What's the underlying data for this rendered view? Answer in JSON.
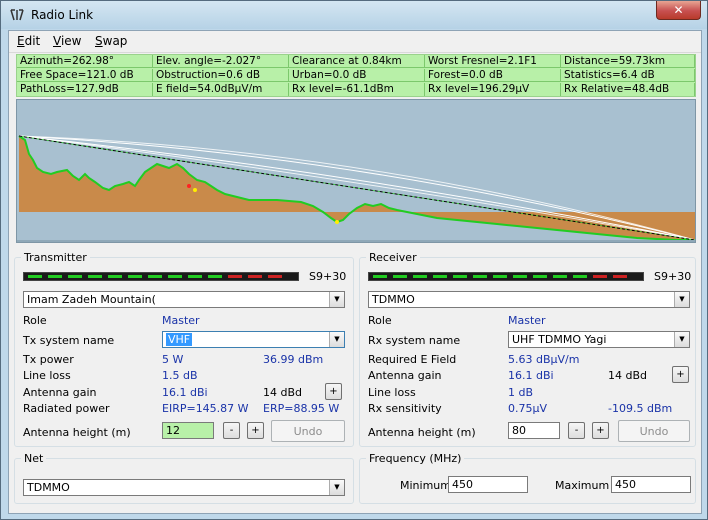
{
  "window": {
    "title": "Radio Link",
    "close_label": "✕"
  },
  "menu": [
    {
      "label": "Edit",
      "accel": "E",
      "rest": "dit"
    },
    {
      "label": "View",
      "accel": "V",
      "rest": "iew"
    },
    {
      "label": "Swap",
      "accel": "S",
      "rest": "wap"
    }
  ],
  "stats": {
    "row1": [
      "Azimuth=262.98°",
      "Elev. angle=-2.027°",
      "Clearance at 0.84km",
      "Worst Fresnel=2.1F1",
      "Distance=59.73km"
    ],
    "row2": [
      "Free Space=121.0 dB",
      "Obstruction=0.6 dB",
      "Urban=0.0 dB",
      "Forest=0.0 dB",
      "Statistics=6.4 dB"
    ],
    "row3": [
      "PathLoss=127.9dB",
      "E field=54.0dBµV/m",
      "Rx level=-61.1dBm",
      "Rx level=196.29µV",
      "Rx Relative=48.4dB"
    ]
  },
  "colors": {
    "stats_bg": "#b8f0a8",
    "terrain": "#c98a4a",
    "terrain_edge": "#22cc22",
    "sky": "#a8c0d0",
    "meter_green": "#22cc22",
    "meter_red": "#cc2222",
    "link_value": "#1a33a8"
  },
  "transmitter": {
    "group_title": "Transmitter",
    "meter_text": "S9+30",
    "site": "Imam Zadeh Mountain(",
    "role_label": "Role",
    "role_value": "Master",
    "system_label": "Tx system name",
    "system_value": "VHF",
    "power_label": "Tx power",
    "power_w": "5 W",
    "power_dbm": "36.99 dBm",
    "line_loss_label": "Line loss",
    "line_loss_value": "1.5 dB",
    "ant_gain_label": "Antenna gain",
    "ant_gain_dbi": "16.1 dBi",
    "ant_gain_dbd": "14 dBd",
    "rad_power_label": "Radiated power",
    "eirp": "EIRP=145.87 W",
    "erp": "ERP=88.95 W",
    "ant_height_label": "Antenna height (m)",
    "ant_height_value": "12",
    "minus": "-",
    "plus": "+",
    "undo": "Undo"
  },
  "receiver": {
    "group_title": "Receiver",
    "meter_text": "S9+30",
    "site": "TDMMO",
    "role_label": "Role",
    "role_value": "Master",
    "system_label": "Rx system name",
    "system_value": "UHF TDMMO Yagi",
    "req_field_label": "Required E Field",
    "req_field_value": "5.63 dBµV/m",
    "ant_gain_label": "Antenna gain",
    "ant_gain_dbi": "16.1 dBi",
    "ant_gain_dbd": "14 dBd",
    "line_loss_label": "Line loss",
    "line_loss_value": "1 dB",
    "sens_label": "Rx sensitivity",
    "sens_uv": "0.75µV",
    "sens_dbm": "-109.5 dBm",
    "ant_height_label": "Antenna height (m)",
    "ant_height_value": "80",
    "minus": "-",
    "plus": "+",
    "undo": "Undo"
  },
  "net": {
    "group_title": "Net",
    "value": "TDMMO"
  },
  "frequency": {
    "group_title": "Frequency (MHz)",
    "min_label": "Minimum",
    "min_value": "450",
    "max_label": "Maximum",
    "max_value": "450"
  }
}
